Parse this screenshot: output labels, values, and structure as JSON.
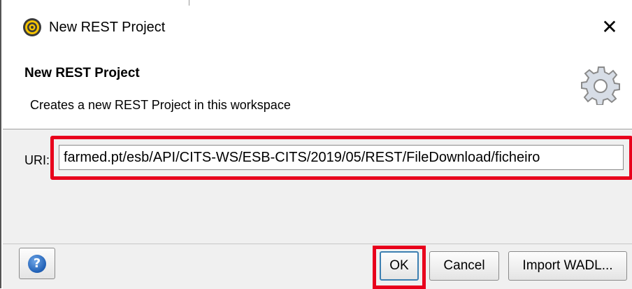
{
  "window": {
    "title": "New REST Project",
    "close_glyph": "✕"
  },
  "banner": {
    "title": "New REST Project",
    "description": "Creates a new REST Project in this workspace",
    "icon": "gear-icon"
  },
  "form": {
    "uri_label": "URI:",
    "uri_value": "farmed.pt/esb/API/CITS-WS/ESB-CITS/2019/05/REST/FileDownload/ficheiro"
  },
  "buttons": {
    "help_glyph": "?",
    "ok_label": "OK",
    "cancel_label": "Cancel",
    "import_label": "Import WADL..."
  },
  "colors": {
    "highlight": "#e8001c",
    "help_blue": "#1f5fb5"
  }
}
